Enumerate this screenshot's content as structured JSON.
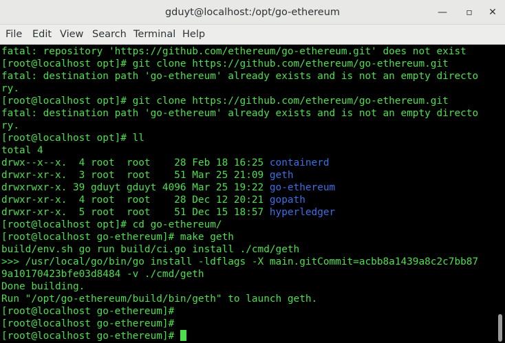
{
  "window": {
    "title": "gduyt@localhost:/opt/go-ethereum",
    "minimize_glyph": "—",
    "maximize_glyph": "▫",
    "close_glyph": "✕"
  },
  "menu": {
    "items": [
      "File",
      "Edit",
      "View",
      "Search",
      "Terminal",
      "Help"
    ]
  },
  "terminal": {
    "colors": {
      "text": "#4ce04c",
      "directory": "#3b6fe8",
      "background": "#000000"
    },
    "lines": [
      "fatal: repository 'https://github.com/ethereum/go-ethereum.git' does not exist",
      "[root@localhost opt]# git clone https://github.com/ethereum/go-ethereum.git",
      "fatal: destination path 'go-ethereum' already exists and is not an empty directo",
      "ry.",
      "[root@localhost opt]# git clone https://github.com/ethereum/go-ethereum.git",
      "fatal: destination path 'go-ethereum' already exists and is not an empty directo",
      "ry.",
      "[root@localhost opt]# ll",
      "total 4"
    ],
    "listing": [
      {
        "meta": "drwx--x--x.  4 root  root    28 Feb 18 16:25 ",
        "name": "containerd"
      },
      {
        "meta": "drwxr-xr-x.  3 root  root    51 Mar 25 21:09 ",
        "name": "geth"
      },
      {
        "meta": "drwxrwxr-x. 39 gduyt gduyt 4096 Mar 25 19:22 ",
        "name": "go-ethereum"
      },
      {
        "meta": "drwxr-xr-x.  4 root  root    28 Dec 12 20:21 ",
        "name": "gopath"
      },
      {
        "meta": "drwxr-xr-x.  5 root  root    51 Dec 15 18:57 ",
        "name": "hyperledger"
      }
    ],
    "after": [
      "[root@localhost opt]# cd go-ethereum/",
      "[root@localhost go-ethereum]# make geth",
      "build/env.sh go run build/ci.go install ./cmd/geth",
      ">>> /usr/local/go/bin/go install -ldflags -X main.gitCommit=acbb8a1439a8c2c7bb87",
      "9a10170423bfe03d8484 -v ./cmd/geth",
      "Done building.",
      "Run \"/opt/go-ethereum/build/bin/geth\" to launch geth.",
      "[root@localhost go-ethereum]#",
      "[root@localhost go-ethereum]#"
    ],
    "prompt": "[root@localhost go-ethereum]# "
  }
}
